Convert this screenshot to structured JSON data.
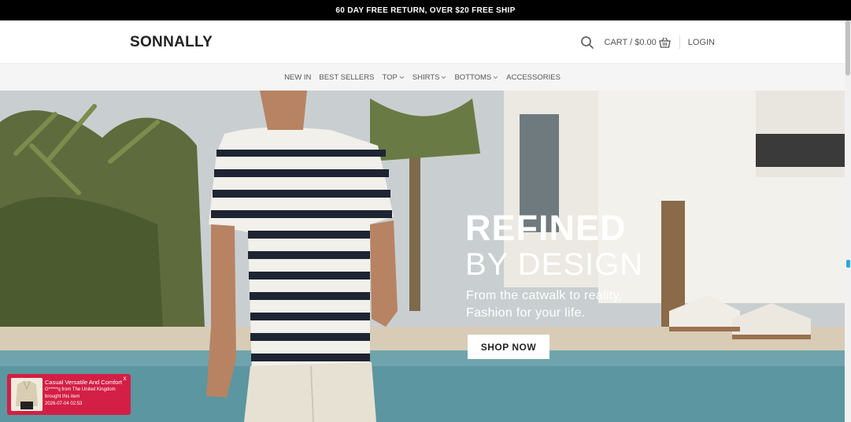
{
  "announcement": "60 DAY FREE RETURN, OVER $20 FREE SHIP",
  "header": {
    "logo": "SONNALLY",
    "cart_label": "CART / $0.00",
    "login_label": "LOGIN",
    "icons": {
      "search": "search-icon",
      "cart": "basket-icon"
    }
  },
  "nav": {
    "items": [
      {
        "label": "NEW IN",
        "dropdown": false
      },
      {
        "label": "BEST SELLERS",
        "dropdown": false
      },
      {
        "label": "TOP",
        "dropdown": true
      },
      {
        "label": "SHIRTS",
        "dropdown": true
      },
      {
        "label": "BOTTOMS",
        "dropdown": true
      },
      {
        "label": "ACCESSORIES",
        "dropdown": false
      }
    ]
  },
  "hero": {
    "title_line1": "REFINED",
    "title_line2": "BY DESIGN",
    "subtitle_line1": "From the catwalk to reality,",
    "subtitle_line2": "Fashion for your life.",
    "cta": "SHOP NOW"
  },
  "popup": {
    "product": "Casual Versatile And Comfort",
    "customer": "G*****q from The United Kingdom",
    "action": "brought this item",
    "timestamp": "2026-07-04 02:53",
    "close": "x"
  },
  "colors": {
    "topbar_bg": "#000000",
    "nav_bg": "#f5f5f5",
    "popup_bg": "#d31f45",
    "accent": "#29a9e0"
  }
}
